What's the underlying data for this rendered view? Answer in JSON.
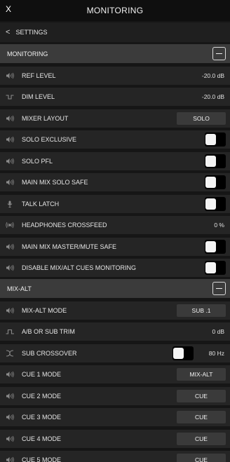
{
  "window": {
    "close_label": "X",
    "title": "MONITORING"
  },
  "nav": {
    "back_label": "SETTINGS"
  },
  "sections": {
    "monitoring": {
      "title": "MONITORING",
      "rows": {
        "ref_level": {
          "label": "REF LEVEL",
          "value": "-20.0 dB"
        },
        "dim_level": {
          "label": "DIM LEVEL",
          "value": "-20.0 dB"
        },
        "mixer_layout": {
          "label": "MIXER LAYOUT",
          "value": "SOLO"
        },
        "solo_exclusive": {
          "label": "SOLO EXCLUSIVE",
          "enabled": false
        },
        "solo_pfl": {
          "label": "SOLO PFL",
          "enabled": false
        },
        "main_mix_solo_safe": {
          "label": "MAIN MIX SOLO SAFE",
          "enabled": false
        },
        "talk_latch": {
          "label": "TALK LATCH",
          "enabled": false
        },
        "headphones_crossfeed": {
          "label": "HEADPHONES CROSSFEED",
          "value": "0 %"
        },
        "main_mix_master_mute_safe": {
          "label": "MAIN MIX MASTER/MUTE SAFE",
          "enabled": false
        },
        "disable_mix_alt_cues": {
          "label": "DISABLE MIX/ALT CUES MONITORING",
          "enabled": false
        }
      }
    },
    "mix_alt": {
      "title": "MIX-ALT",
      "rows": {
        "mix_alt_mode": {
          "label": "MIX-ALT MODE",
          "value": "SUB .1"
        },
        "ab_sub_trim": {
          "label": "A/B OR SUB TRIM",
          "value": "0 dB"
        },
        "sub_crossover": {
          "label": "SUB CROSSOVER",
          "value": "80 Hz",
          "enabled": false
        },
        "cue1": {
          "label": "CUE 1 MODE",
          "value": "MIX-ALT"
        },
        "cue2": {
          "label": "CUE 2 MODE",
          "value": "CUE"
        },
        "cue3": {
          "label": "CUE 3 MODE",
          "value": "CUE"
        },
        "cue4": {
          "label": "CUE 4 MODE",
          "value": "CUE"
        },
        "cue5": {
          "label": "CUE 5 MODE",
          "value": "CUE"
        }
      }
    }
  },
  "icons": {
    "speaker": "speaker-icon",
    "dim": "dim-step-icon",
    "mic": "microphone-icon",
    "headphones": "crossfeed-icon",
    "trim": "trim-step-icon",
    "crossover": "crossover-icon"
  },
  "colors": {
    "background": "#161616",
    "row": "#252525",
    "section": "#3b3b3b",
    "button": "#3a3a3a",
    "toggle_track": "#000000",
    "toggle_knob": "#f4f4f4"
  }
}
